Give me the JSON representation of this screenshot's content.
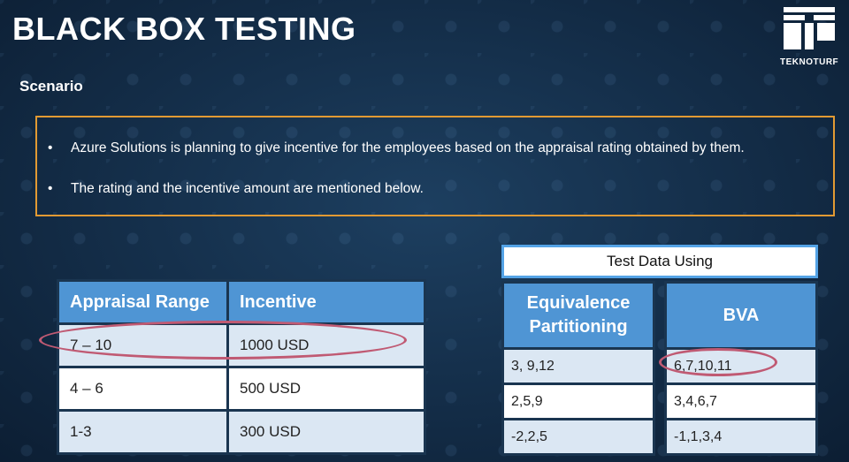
{
  "slide": {
    "title": "BLACK BOX TESTING",
    "logo_text": "TEKNOTURF",
    "scenario_heading": "Scenario",
    "bullets": [
      "Azure Solutions is planning to give incentive for the employees based on the appraisal rating obtained by them.",
      "The rating and the incentive amount are mentioned below."
    ]
  },
  "rating_table": {
    "headers": [
      "Appraisal Range",
      "Incentive"
    ],
    "rows": [
      [
        "7 – 10",
        "1000 USD"
      ],
      [
        "4 – 6",
        "500 USD"
      ],
      [
        "1-3",
        "300 USD"
      ]
    ]
  },
  "test_data": {
    "banner": "Test Data Using",
    "equivalence": {
      "header_line1": "Equivalence",
      "header_line2": "Partitioning",
      "rows": [
        "3, 9,12",
        "2,5,9",
        "-2,2,5"
      ]
    },
    "bva": {
      "header": "BVA",
      "rows": [
        "6,7,10,11",
        "3,4,6,7",
        "-1,1,3,4"
      ]
    }
  },
  "colors": {
    "accent_border": "#e29a33",
    "header_blue": "#4f95d4",
    "highlight_ellipse": "#c05a73"
  }
}
